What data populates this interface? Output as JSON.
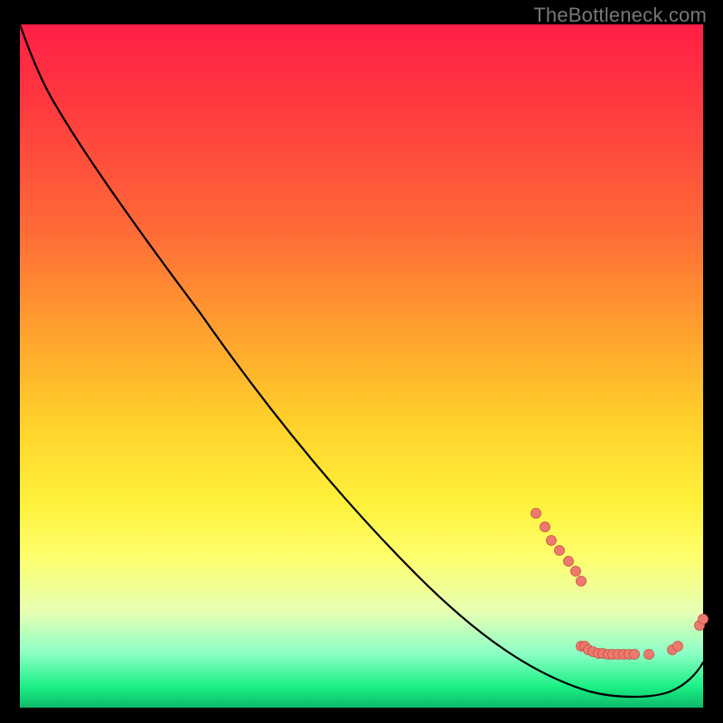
{
  "watermark": "TheBottleneck.com",
  "chart_data": {
    "type": "line",
    "title": "",
    "xlabel": "",
    "ylabel": "",
    "xlim": [
      0,
      100
    ],
    "ylim": [
      0,
      100
    ],
    "series": [
      {
        "name": "curve",
        "x": [
          0,
          5,
          10,
          15,
          20,
          25,
          30,
          35,
          40,
          45,
          50,
          55,
          60,
          65,
          70,
          75,
          80,
          82,
          84,
          86,
          88,
          90,
          92,
          94,
          96,
          98,
          100
        ],
        "y": [
          100,
          98,
          95,
          90,
          84,
          78,
          71,
          64,
          57,
          50,
          43,
          36,
          29,
          23,
          17,
          12,
          8,
          7.5,
          7,
          6.8,
          7,
          7,
          7,
          7,
          8,
          10,
          13
        ]
      }
    ],
    "markers": [
      {
        "x": 75.5,
        "y": 28.5
      },
      {
        "x": 76.8,
        "y": 26.5
      },
      {
        "x": 77.8,
        "y": 24.5
      },
      {
        "x": 79.0,
        "y": 23.0
      },
      {
        "x": 80.3,
        "y": 21.5
      },
      {
        "x": 81.3,
        "y": 20.0
      },
      {
        "x": 82.1,
        "y": 18.5
      },
      {
        "x": 82.1,
        "y": 9.0
      },
      {
        "x": 82.6,
        "y": 9.0
      },
      {
        "x": 83.2,
        "y": 8.5
      },
      {
        "x": 83.9,
        "y": 8.2
      },
      {
        "x": 84.7,
        "y": 8.0
      },
      {
        "x": 85.3,
        "y": 8.0
      },
      {
        "x": 86.1,
        "y": 7.8
      },
      {
        "x": 86.8,
        "y": 7.8
      },
      {
        "x": 87.6,
        "y": 7.8
      },
      {
        "x": 88.4,
        "y": 7.8
      },
      {
        "x": 89.2,
        "y": 7.8
      },
      {
        "x": 90.0,
        "y": 7.8
      },
      {
        "x": 92.1,
        "y": 7.8
      },
      {
        "x": 95.5,
        "y": 8.5
      },
      {
        "x": 96.3,
        "y": 9.0
      },
      {
        "x": 99.5,
        "y": 12.0
      },
      {
        "x": 100.0,
        "y": 13.0
      }
    ],
    "colors": {
      "curve": "#000000",
      "marker_fill": "#ed7a6f",
      "marker_stroke": "#c94f43"
    }
  }
}
